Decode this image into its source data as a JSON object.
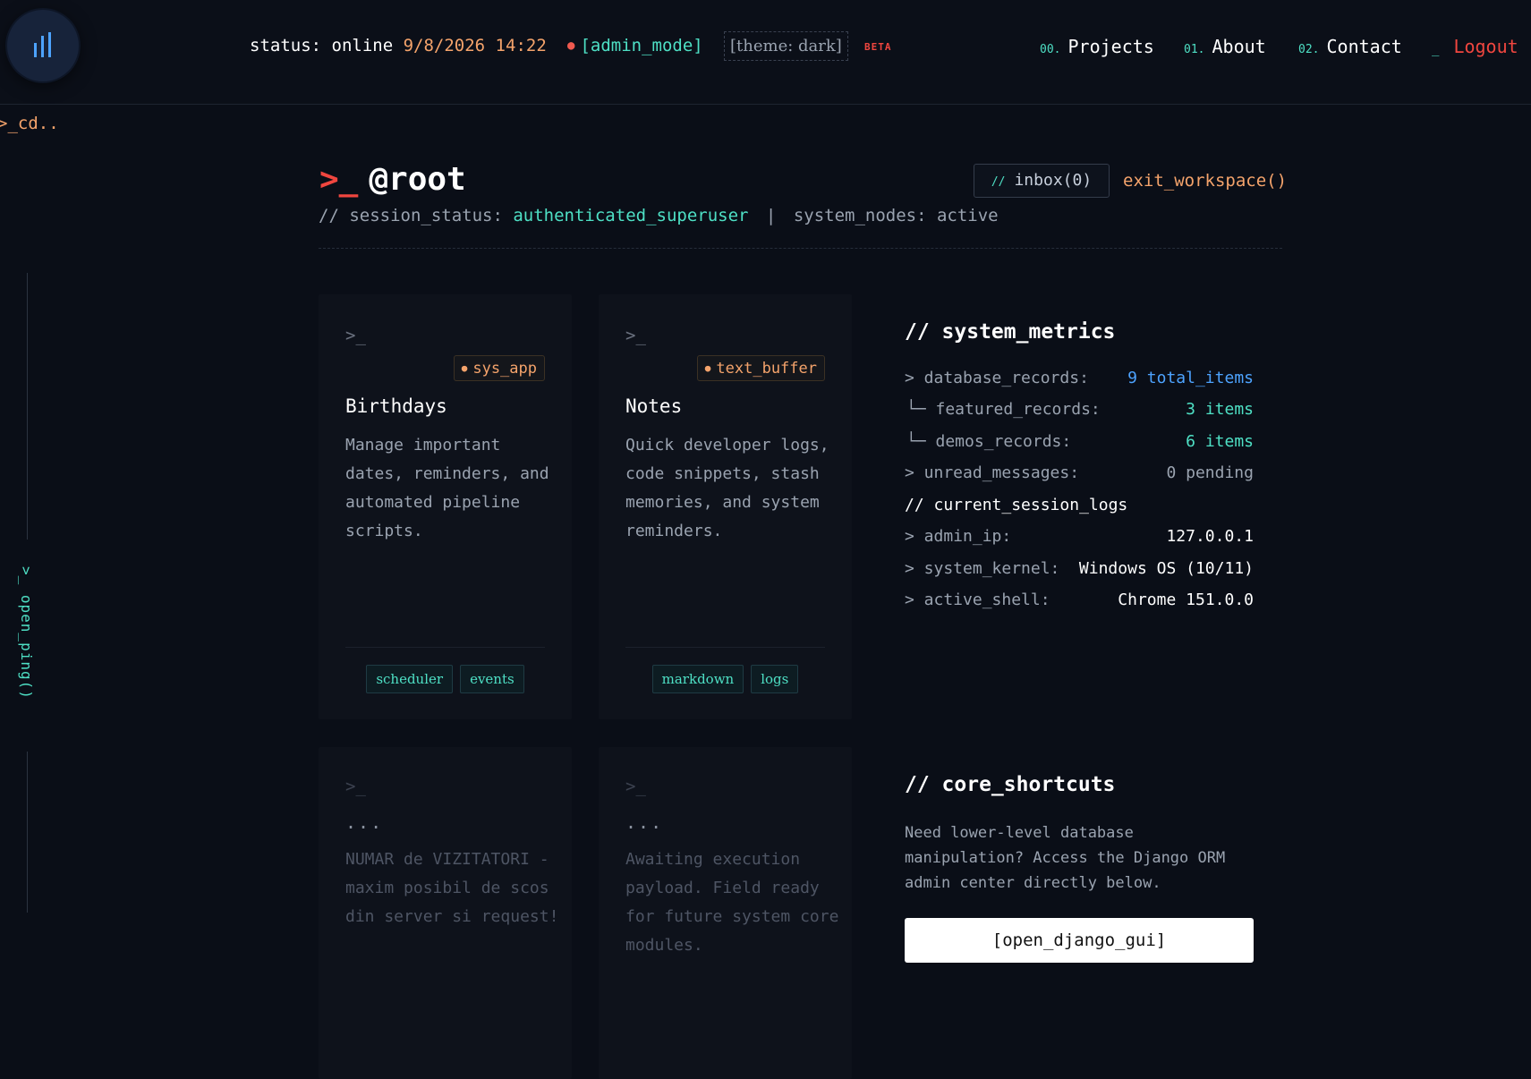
{
  "header": {
    "status_label": "status: online",
    "datetime": "9/8/2026 14:22",
    "admin_mode": "[admin_mode]",
    "theme": "[theme: dark]",
    "beta": "BETA",
    "nav": [
      {
        "num": "00.",
        "label": "Projects"
      },
      {
        "num": "01.",
        "label": "About"
      },
      {
        "num": "02.",
        "label": "Contact"
      }
    ],
    "logout_prefix": "_",
    "logout": "Logout"
  },
  "aside": {
    "cd_link": ">_cd..",
    "ping": ">_ open_ping()"
  },
  "page": {
    "prompt": ">_",
    "title": "@root",
    "inbox_prefix": "//",
    "inbox": "inbox(0)",
    "exit": "exit_workspace()",
    "session_key": "// session_status:",
    "session_value": "authenticated_superuser",
    "session_sep": "|",
    "nodes": "system_nodes: active"
  },
  "cards": [
    {
      "prompt": ">_",
      "badge": "sys_app",
      "title": "Birthdays",
      "desc": "Manage important dates, reminders, and automated pipeline scripts.",
      "tags": [
        "scheduler",
        "events"
      ]
    },
    {
      "prompt": ">_",
      "badge": "text_buffer",
      "title": "Notes",
      "desc": "Quick developer logs, code snippets, stash memories, and system reminders.",
      "tags": [
        "markdown",
        "logs"
      ]
    },
    {
      "prompt": ">_",
      "dots": "...",
      "desc": "NUMAR de VIZITATORI - maxim posibil de scos din server si request!"
    },
    {
      "prompt": ">_",
      "dots": "...",
      "desc": "Awaiting execution payload. Field ready for future system core modules."
    }
  ],
  "metrics": {
    "title": "// system_metrics",
    "rows": [
      {
        "key": "> database_records:",
        "value": "9 total_items"
      },
      {
        "key": "└─ featured_records:",
        "value": "3 items"
      },
      {
        "key": "└─ demos_records:",
        "value": "6 items"
      },
      {
        "key": "> unread_messages:",
        "value": "0 pending"
      },
      {
        "key": "// current_session_logs",
        "value": ""
      },
      {
        "key": "> admin_ip:",
        "value": "127.0.0.1"
      },
      {
        "key": "> system_kernel:",
        "value": "Windows OS (10/11)"
      },
      {
        "key": "> active_shell:",
        "value": "Chrome 151.0.0"
      }
    ]
  },
  "shortcuts": {
    "title": "// core_shortcuts",
    "desc": "Need lower-level database manipulation? Access the Django ORM admin center directly below.",
    "button": "[open_django_gui]"
  },
  "colors": {
    "background": "#0a0e17",
    "accent_teal": "#4ee0c5",
    "accent_orange": "#f4a36b",
    "accent_red": "#f0463f",
    "accent_blue": "#4da3ff"
  },
  "icons": {
    "logo": "bars-icon"
  }
}
